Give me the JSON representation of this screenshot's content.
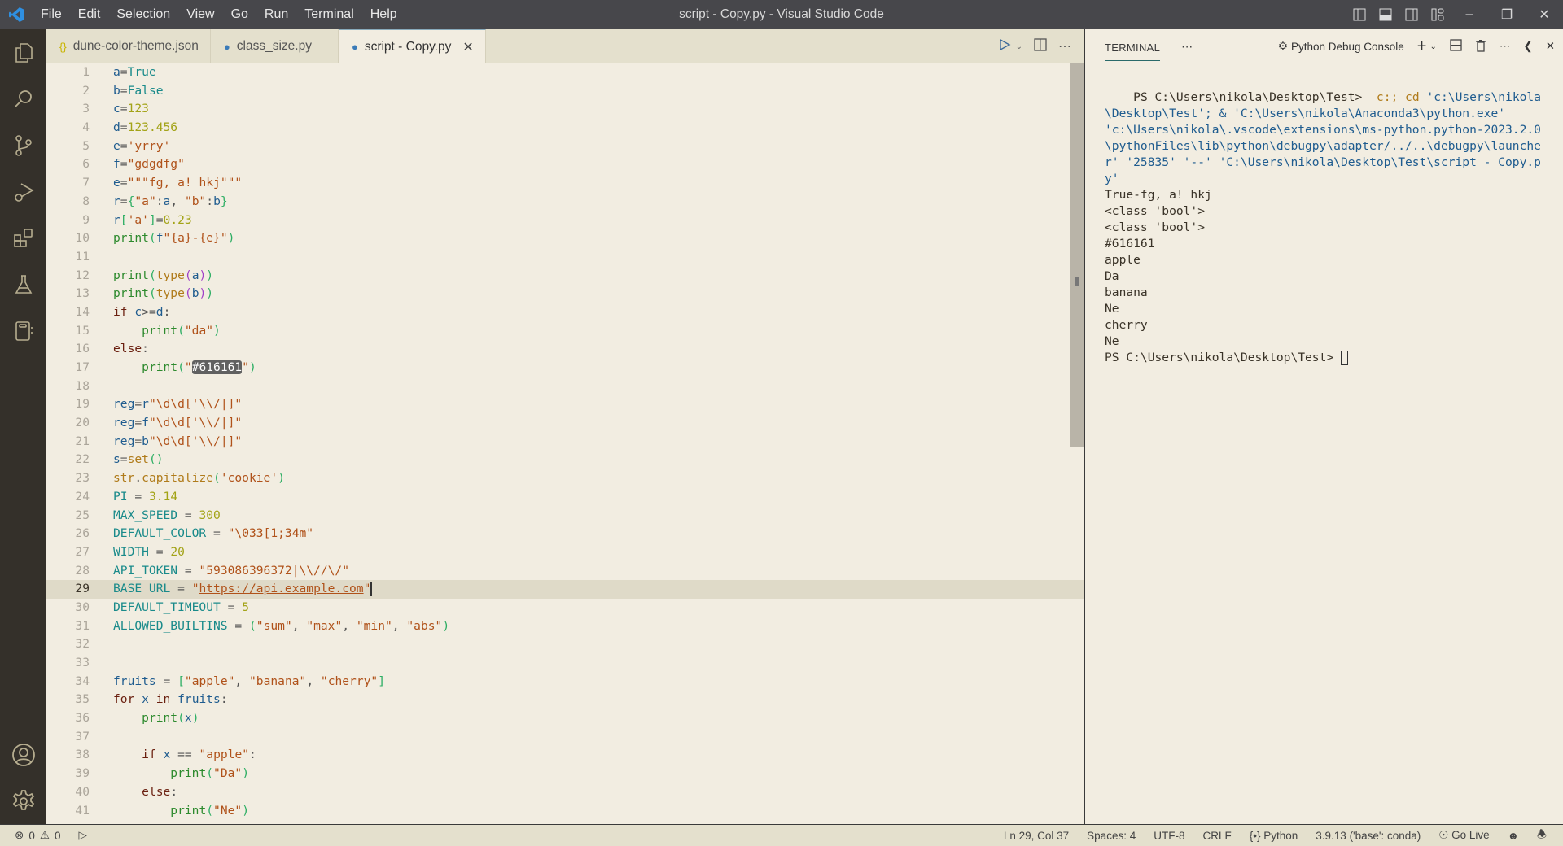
{
  "window": {
    "title": "script - Copy.py - Visual Studio Code",
    "menu": [
      "File",
      "Edit",
      "Selection",
      "View",
      "Go",
      "Run",
      "Terminal",
      "Help"
    ]
  },
  "activity_bar": {
    "items": [
      "explorer",
      "search",
      "source-control",
      "run-and-debug",
      "extensions",
      "testing",
      "notebook"
    ],
    "bottom": [
      "accounts",
      "manage"
    ]
  },
  "tabs": [
    {
      "label": "dune-color-theme.json",
      "icon": "{}",
      "active": false
    },
    {
      "label": "class_size.py",
      "icon": "python",
      "active": false
    },
    {
      "label": "script - Copy.py",
      "icon": "python",
      "active": true
    }
  ],
  "editor": {
    "current_line": 29,
    "selection_text": "#616161",
    "lines": [
      "a=True",
      "b=False",
      "c=123",
      "d=123.456",
      "e='yrry'",
      "f=\"gdgdfg\"",
      "e=\"\"\"fg, a! hkj\"\"\"",
      "r={\"a\":a, \"b\":b}",
      "r['a']=0.23",
      "print(f\"{a}-{e}\")",
      "",
      "print(type(a))",
      "print(type(b))",
      "if c>=d:",
      "    print(\"da\")",
      "else:",
      "    print(\"#616161\")",
      "",
      "reg=r\"\\d\\d['\\\\/|]\"",
      "reg=f\"\\d\\d['\\\\/|]\"",
      "reg=b\"\\d\\d['\\\\/|]\"",
      "s=set()",
      "str.capitalize('cookie')",
      "PI = 3.14",
      "MAX_SPEED = 300",
      "DEFAULT_COLOR = \"\\033[1;34m\"",
      "WIDTH = 20",
      "API_TOKEN = \"593086396372|\\\\//\\/\"",
      "BASE_URL = \"https://api.example.com\"",
      "DEFAULT_TIMEOUT = 5",
      "ALLOWED_BUILTINS = (\"sum\", \"max\", \"min\", \"abs\")",
      "",
      "",
      "fruits = [\"apple\", \"banana\", \"cherry\"]",
      "for x in fruits:",
      "    print(x)",
      "",
      "    if x == \"apple\":",
      "        print(\"Da\")",
      "    else:",
      "        print(\"Ne\")"
    ]
  },
  "panel": {
    "tab_label": "TERMINAL",
    "terminal_name": "Python Debug Console",
    "prompt": "PS C:\\Users\\nikola\\Desktop\\Test>",
    "command_prefix": "c:; cd",
    "command_rest": "'c:\\Users\\nikola\\Desktop\\Test'; & 'C:\\Users\\nikola\\Anaconda3\\python.exe' 'c:\\Users\\nikola\\.vscode\\extensions\\ms-python.python-2023.2.0\\pythonFiles\\lib\\python\\debugpy\\adapter/../..\\debugpy\\launcher' '25835' '--' 'C:\\Users\\nikola\\Desktop\\Test\\script - Copy.py'",
    "output": [
      "True-fg, a! hkj",
      "<class 'bool'>",
      "<class 'bool'>",
      "#616161",
      "apple",
      "Da",
      "banana",
      "Ne",
      "cherry",
      "Ne"
    ],
    "final_prompt": "PS C:\\Users\\nikola\\Desktop\\Test>"
  },
  "statusbar": {
    "errors": "0",
    "warnings": "0",
    "position": "Ln 29, Col 37",
    "indent": "Spaces: 4",
    "encoding": "UTF-8",
    "eol": "CRLF",
    "language": "Python",
    "interpreter": "3.9.13 ('base': conda)",
    "go_live": "Go Live"
  }
}
